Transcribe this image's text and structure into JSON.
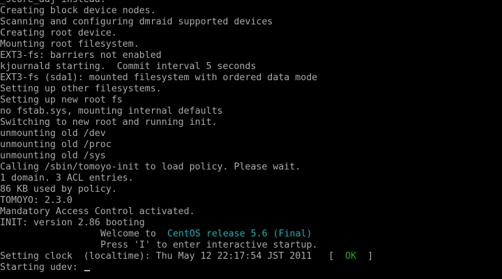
{
  "console": {
    "lines": [
      "_score_adj instead.",
      "Creating block device nodes.",
      "Scanning and configuring dmraid supported devices",
      "Creating root device.",
      "Mounting root filesystem.",
      "EXT3-fs: barriers not enabled",
      "kjournald starting.  Commit interval 5 seconds",
      "EXT3-fs (sda1): mounted filesystem with ordered data mode",
      "Setting up other filesystems.",
      "Setting up new root fs",
      "no fstab.sys, mounting internal defaults",
      "Switching to new root and running init.",
      "unmounting old /dev",
      "unmounting old /proc",
      "unmounting old /sys",
      "Calling /sbin/tomoyo-init to load policy. Please wait.",
      "1 domain. 3 ACL entries.",
      "86 KB used by policy.",
      "TOMOYO: 2.3.0",
      "Mandatory Access Control activated.",
      "INIT: version 2.86 booting"
    ],
    "welcome": {
      "prefix": "Welcome to  ",
      "release": "CentOS release 5.6 (Final)"
    },
    "press_hint": "Press 'I' to enter interactive startup.",
    "clock": {
      "text": "Setting clock  (localtime): Thu May 12 22:17:54 JST 2011   ",
      "bracket_open": "[  ",
      "status": "OK",
      "bracket_close": "  ]"
    },
    "prompt": "Starting udev: "
  },
  "colors": {
    "background": "#000000",
    "text": "#aaaaaa",
    "release_highlight": "#18b2b2",
    "ok_status": "#18b218"
  }
}
